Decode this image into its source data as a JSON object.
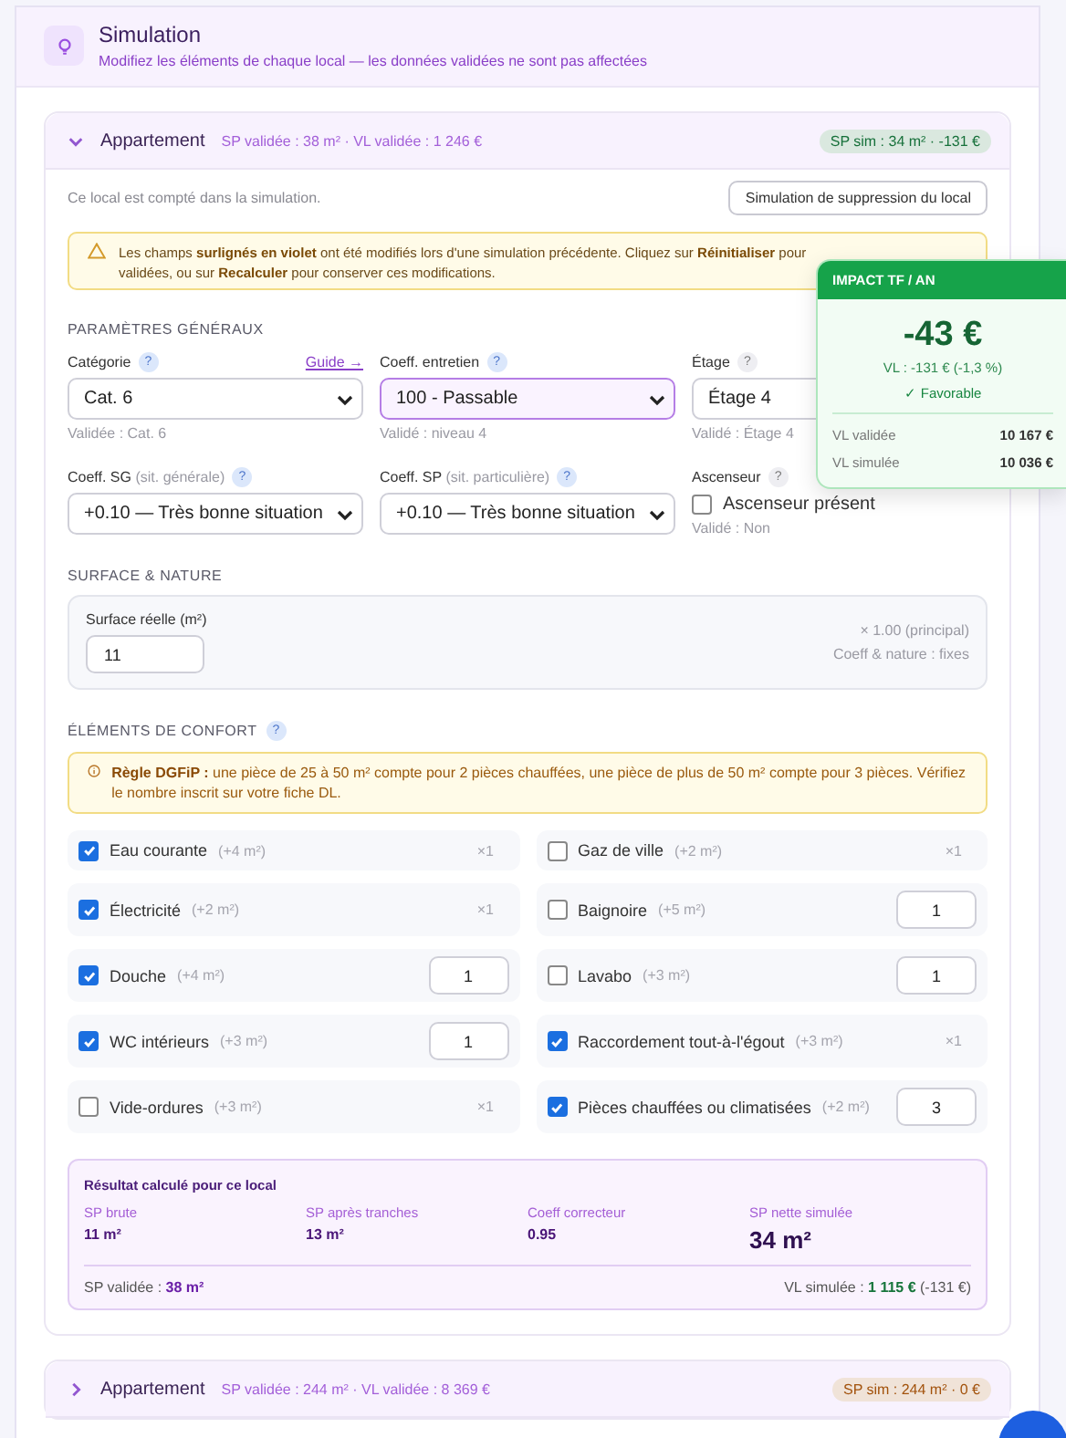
{
  "header": {
    "title": "Simulation",
    "subtitle": "Modifiez les éléments de chaque local — les données validées ne sont pas affectées"
  },
  "locals": [
    {
      "name": "Appartement",
      "meta": "SP validée : 38 m² · VL validée : 1 246 €",
      "badge": "SP sim : 34 m² · -131 €",
      "color": "#16703a",
      "expanded": true,
      "note": "Ce local est compté dans la simulation.",
      "delete_button": "Simulation de suppression du local",
      "warning": [
        "Les champs **surlignés en violet** ont été modifiés lors d'une simulation précédente. Cliquez sur **Réinitialiser** pour",
        "validées, ou sur **Recalculer** pour conserver ces modifications."
      ],
      "general_title": "PARAMÈTRES GÉNÉRAUX",
      "fields": [
        {
          "kind": "select",
          "label": "Catégorie",
          "help": "?",
          "help_muted": false,
          "link": "Guide →",
          "value": "Cat. 6",
          "hint": "Validée : Cat. 6",
          "modified": false
        },
        {
          "kind": "select",
          "label": "Coeff. entretien",
          "help": "?",
          "help_muted": false,
          "value": "100 - Passable",
          "hint": "Validé : niveau 4",
          "modified": true
        },
        {
          "kind": "select",
          "label": "Étage",
          "help": "?",
          "help_muted": true,
          "value": "Étage 4",
          "hint": "Validé : Étage 4",
          "modified": false
        },
        {
          "kind": "select",
          "label": "Coeff. SG",
          "label_note": "(sit. générale)",
          "help": "?",
          "help_muted": false,
          "value": "+0.10 — Très bonne situation",
          "modified": false
        },
        {
          "kind": "select",
          "label": "Coeff. SP",
          "label_note": "(sit. particulière)",
          "help": "?",
          "help_muted": false,
          "value": "+0.10 — Très bonne situation",
          "modified": false
        },
        {
          "kind": "checkbox",
          "label": "Ascenseur",
          "help": "?",
          "help_muted": true,
          "value": "Ascenseur présent",
          "checked": false,
          "hint": "Validé : Non",
          "modified": false
        }
      ],
      "surface_title": "SURFACE & NATURE",
      "surface": {
        "label": "Surface réelle (m²)",
        "value": "11",
        "coef": "× 1.00 (principal)",
        "nature": "Coeff & nature : fixes"
      },
      "comfort_title": "ÉLÉMENTS DE CONFORT",
      "comfort_help": "?",
      "rule": "**Règle DGFiP :** une pièce de 25 à 50 m² compte pour 2 pièces chauffées, une pièce de plus de 50 m² compte pour 3 pièces. Vérifiez le nombre inscrit sur votre fiche DL.",
      "comfort": [
        {
          "name": "Eau courante",
          "area": "(+4 m²)",
          "checked": true,
          "kind": "fixed",
          "count": "×1"
        },
        {
          "name": "Gaz de ville",
          "area": "(+2 m²)",
          "checked": false,
          "kind": "fixed",
          "count": "×1"
        },
        {
          "name": "Électricité",
          "area": "(+2 m²)",
          "checked": true,
          "kind": "fixed",
          "count": "×1"
        },
        {
          "name": "Baignoire",
          "area": "(+5 m²)",
          "checked": false,
          "kind": "input",
          "count": "1"
        },
        {
          "name": "Douche",
          "area": "(+4 m²)",
          "checked": true,
          "kind": "input",
          "count": "1"
        },
        {
          "name": "Lavabo",
          "area": "(+3 m²)",
          "checked": false,
          "kind": "input",
          "count": "1"
        },
        {
          "name": "WC intérieurs",
          "area": "(+3 m²)",
          "checked": true,
          "kind": "input",
          "count": "1"
        },
        {
          "name": "Raccordement tout-à-l'égout",
          "area": "(+3 m²)",
          "checked": true,
          "kind": "fixed",
          "count": "×1"
        },
        {
          "name": "Vide-ordures",
          "area": "(+3 m²)",
          "checked": false,
          "kind": "fixed",
          "count": "×1"
        },
        {
          "name": "Pièces chauffées ou climatisées",
          "area": "(+2 m²)",
          "checked": true,
          "kind": "input",
          "count": "3"
        }
      ],
      "result": {
        "title": "Résultat calculé pour ce local",
        "stats": [
          {
            "label": "SP brute",
            "value": "11 m²",
            "big": false
          },
          {
            "label": "SP après tranches",
            "value": "13 m²",
            "big": false
          },
          {
            "label": "Coeff correcteur",
            "value": "0.95",
            "big": false
          },
          {
            "label": "SP nette simulée",
            "value": "34 m²",
            "big": true
          }
        ],
        "validated": "SP validée : **38 m²**",
        "simulated": "VL simulée : **1 115 €** (-131 €)"
      }
    },
    {
      "name": "Appartement",
      "meta": "SP validée : 244 m² · VL validée : 8 369 €",
      "badge": "SP sim : 244 m² · 0 €",
      "color": "#a2520c",
      "expanded": false
    }
  ],
  "impact": {
    "title": "IMPACT TF / AN",
    "amount": "-43 €",
    "delta": "VL : -131 € (-1,3 %)",
    "verdict": "✓ Favorable",
    "rows": [
      {
        "label": "VL validée",
        "value": "10 167 €"
      },
      {
        "label": "VL simulée",
        "value": "10 036 €"
      }
    ]
  }
}
